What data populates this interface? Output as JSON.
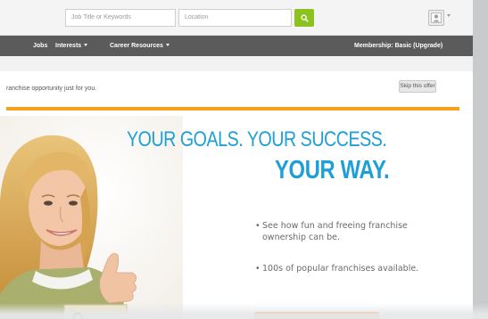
{
  "search": {
    "keywords_placeholder": "Job Title or Keywords",
    "location_placeholder": "Location"
  },
  "nav": {
    "jobs": "Jobs",
    "interests": "Interests",
    "career_resources": "Career Resources",
    "membership": "Membership: Basic (Upgrade)"
  },
  "ad": {
    "header_text": "ranchise opportunity just for you.",
    "skip_label": "Skip this offer",
    "headline_line1": "YOUR GOALS. YOUR SUCCESS.",
    "headline_line2": "YOUR WAY.",
    "bullets": [
      "See how fun and freeing franchise ownership can be.",
      "100s of popular franchises available."
    ]
  },
  "colors": {
    "search_green": "#8cc21f",
    "nav_bg": "#5b5b5b",
    "accent_orange": "#f4a21d",
    "headline_blue": "#1ea0d6"
  },
  "icons": {
    "search": "search-icon",
    "user_menu": "user-avatar-icon"
  }
}
